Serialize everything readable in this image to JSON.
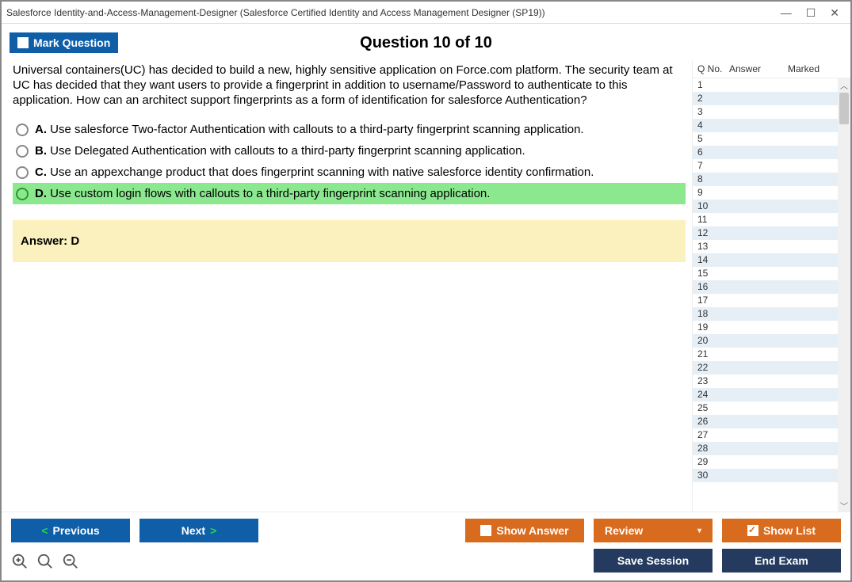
{
  "window": {
    "title": "Salesforce Identity-and-Access-Management-Designer (Salesforce Certified Identity and Access Management Designer (SP19))"
  },
  "header": {
    "mark_label": "Mark Question",
    "question_title": "Question 10 of 10"
  },
  "question": {
    "text": "Universal containers(UC) has decided to build a new, highly sensitive application on Force.com platform. The security team at UC has decided that they want users to provide a fingerprint in addition to username/Password to authenticate to this application. How can an architect support fingerprints as a form of identification for salesforce Authentication?",
    "options": [
      {
        "letter": "A.",
        "text": "Use salesforce Two-factor Authentication with callouts to a third-party fingerprint scanning application.",
        "highlight": false
      },
      {
        "letter": "B.",
        "text": "Use Delegated Authentication with callouts to a third-party fingerprint scanning application.",
        "highlight": false
      },
      {
        "letter": "C.",
        "text": "Use an appexchange product that does fingerprint scanning with native salesforce identity confirmation.",
        "highlight": false
      },
      {
        "letter": "D.",
        "text": "Use custom login flows with callouts to a third-party fingerprint scanning application.",
        "highlight": true
      }
    ],
    "answer_label": "Answer: D"
  },
  "sidebar": {
    "head_qno": "Q No.",
    "head_answer": "Answer",
    "head_marked": "Marked",
    "rows": [
      "1",
      "2",
      "3",
      "4",
      "5",
      "6",
      "7",
      "8",
      "9",
      "10",
      "11",
      "12",
      "13",
      "14",
      "15",
      "16",
      "17",
      "18",
      "19",
      "20",
      "21",
      "22",
      "23",
      "24",
      "25",
      "26",
      "27",
      "28",
      "29",
      "30"
    ]
  },
  "footer": {
    "previous": "Previous",
    "next": "Next",
    "show_answer": "Show Answer",
    "review": "Review",
    "show_list": "Show List",
    "save_session": "Save Session",
    "end_exam": "End Exam"
  }
}
